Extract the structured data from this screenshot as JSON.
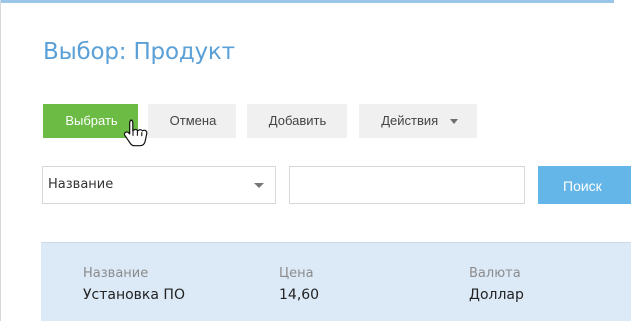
{
  "page": {
    "title": "Выбор: Продукт"
  },
  "toolbar": {
    "select_label": "Выбрать",
    "cancel_label": "Отмена",
    "add_label": "Добавить",
    "actions_label": "Действия"
  },
  "search": {
    "field_label": "Название",
    "input_value": "",
    "button_label": "Поиск"
  },
  "results": {
    "columns": [
      {
        "label": "Название"
      },
      {
        "label": "Цена"
      },
      {
        "label": "Валюта"
      }
    ],
    "rows": [
      {
        "name": "Установка ПО",
        "price": "14,60",
        "currency": "Доллар"
      }
    ]
  },
  "icons": {
    "cursor": "pointer-hand-icon",
    "dropdown": "chevron-down-icon"
  },
  "colors": {
    "title": "#5ba0d6",
    "select_button": "#6bbb45",
    "search_button": "#64b5e8",
    "result_panel": "#dce9f7",
    "top_rule": "#9ac6e8"
  }
}
